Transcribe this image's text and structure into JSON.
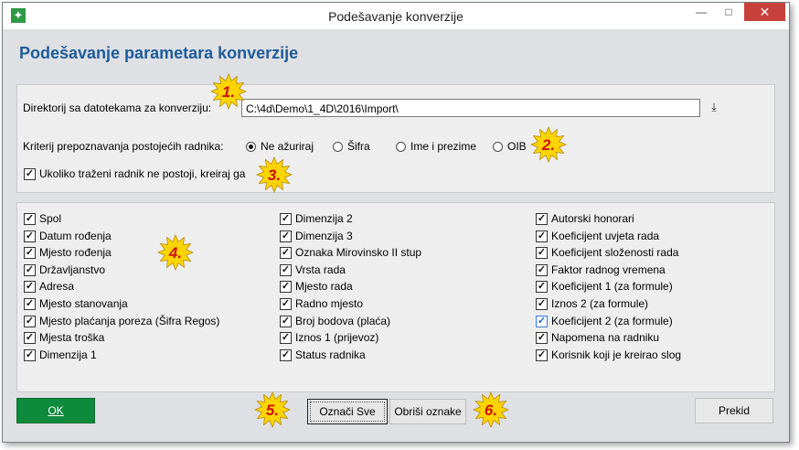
{
  "window": {
    "title": "Podešavanje konverzije",
    "close": "✕",
    "minimize": "—",
    "maximize": "□"
  },
  "heading": "Podešavanje parametara konverzije",
  "directory": {
    "label": "Direktorij sa datotekama za konverziju:",
    "value": "C:\\4d\\Demo\\1_4D\\2016\\Import\\",
    "button_icon": "download-icon"
  },
  "criteria": {
    "label": "Kriterij prepoznavanja postojećih radnika:",
    "options": [
      "Ne ažuriraj",
      "Šifra",
      "Ime i prezime",
      "OIB"
    ],
    "selected": "Ne ažuriraj"
  },
  "create_missing": {
    "label": "Ukoliko traženi radnik ne postoji, kreiraj ga",
    "checked": true
  },
  "fields": {
    "col1": [
      "Spol",
      "Datum rođenja",
      "Mjesto rođenja",
      "Državljanstvo",
      "Adresa",
      "Mjesto stanovanja",
      "Mjesto plaćanja poreza (Šifra Regos)",
      "Mjesta troška",
      "Dimenzija 1"
    ],
    "col2": [
      "Dimenzija 2",
      "Dimenzija 3",
      "Oznaka Mirovinsko II stup",
      "Vrsta rada",
      "Mjesto rada",
      "Radno mjesto",
      "Broj bodova (plaća)",
      "Iznos 1 (prijevoz)",
      "Status radnika"
    ],
    "col3": [
      "Autorski honorari",
      "Koeficijent uvjeta rada",
      "Koeficijent složenosti rada",
      "Faktor radnog vremena",
      "Koeficijent 1 (za formule)",
      "Iznos 2 (za formule)",
      "Koeficijent 2 (za formule)",
      "Napomena na radniku",
      "Korisnik koji je kreirao slog"
    ]
  },
  "buttons": {
    "ok": "OK",
    "mark_all": "Označi Sve",
    "clear_marks": "Obriši oznake",
    "cancel": "Prekid"
  },
  "markers": [
    "1.",
    "2.",
    "3.",
    "4.",
    "5.",
    "6."
  ],
  "colors": {
    "accent": "#1d5c9a",
    "ok_button": "#0e8a3c",
    "marker_fill": "#ffd400",
    "marker_text": "#cc1010"
  }
}
